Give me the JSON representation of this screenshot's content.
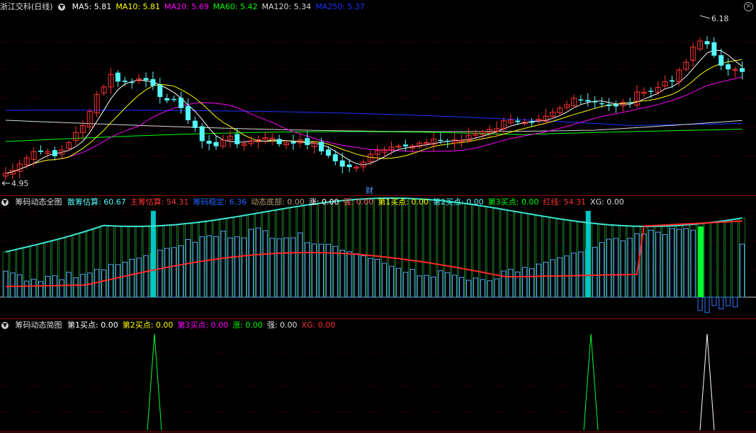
{
  "main_header": {
    "stock_name": "浙江交科(日线)",
    "ma": [
      {
        "label": "MA5: 5.81",
        "color": "#ffffff"
      },
      {
        "label": "MA10: 5.81",
        "color": "#ffff00"
      },
      {
        "label": "MA20: 5.69",
        "color": "#ff00ff"
      },
      {
        "label": "MA60: 5.42",
        "color": "#00ff00"
      },
      {
        "label": "MA120: 5.34",
        "color": "#d8d8d8"
      },
      {
        "label": "MA250: 5.37",
        "color": "#1e32ff"
      }
    ]
  },
  "main_chart": {
    "price_high_label": "6.18",
    "price_low_label": "4.95",
    "marker_label": "财",
    "colors": {
      "up": "#ff3232",
      "down": "#54fcfc",
      "ma5": "#ffffff",
      "ma10": "#ffff00",
      "ma20": "#ff00ff",
      "ma60": "#00ff00",
      "ma120": "#d8d8d8",
      "ma250": "#1e32ff"
    }
  },
  "panel2": {
    "title": "筹码动态全图",
    "fields": [
      {
        "label": "散筹估算: 60.67",
        "color": "#54fcfc"
      },
      {
        "label": "主筹估算: 54.31",
        "color": "#ff3232"
      },
      {
        "label": "筹码稳定: 6.36",
        "color": "#1e64ff"
      },
      {
        "label": "动态底部: 0.00",
        "color": "#b4a078"
      },
      {
        "label": "涨: 0.00",
        "color": "#ffffff"
      },
      {
        "label": "强: 0.00",
        "color": "#ff5a5a"
      },
      {
        "label": "第1买点: 0.00",
        "color": "#ffff00"
      },
      {
        "label": "第2买点: 0.00",
        "color": "#54fcfc"
      },
      {
        "label": "第3买点: 0.00",
        "color": "#00ff00"
      },
      {
        "label": "红线: 54.31",
        "color": "#ff3232"
      },
      {
        "label": "XG: 0.00",
        "color": "#dddddd"
      }
    ]
  },
  "panel3": {
    "title": "筹码动态简图",
    "fields": [
      {
        "label": "第1买点: 0.00",
        "color": "#ffffff"
      },
      {
        "label": "第2买点: 0.00",
        "color": "#ffff00"
      },
      {
        "label": "第3买点: 0.00",
        "color": "#ff00ff"
      },
      {
        "label": "涨: 0.00",
        "color": "#00ff00"
      },
      {
        "label": "强: 0.00",
        "color": "#dddddd"
      },
      {
        "label": "XG: 0.00",
        "color": "#ff3232"
      }
    ]
  }
}
